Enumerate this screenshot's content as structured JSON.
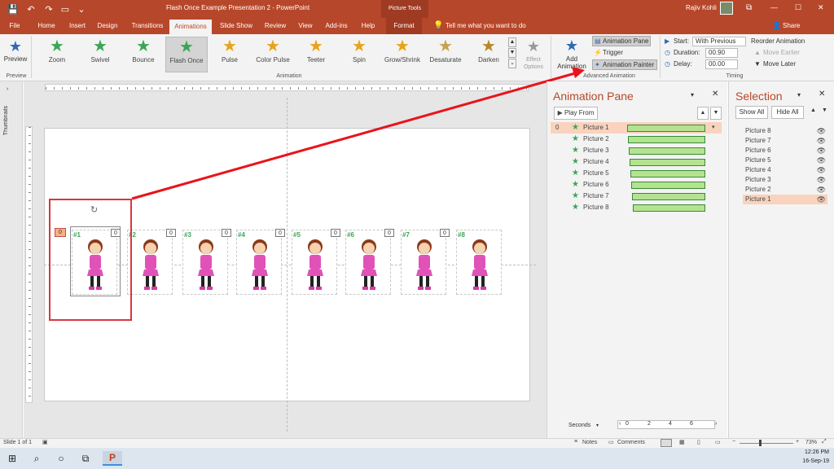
{
  "titlebar": {
    "title": "Flash Once Example Presentation 2  -  PowerPoint",
    "context_tab": "Picture Tools",
    "user": "Rajiv Kohli",
    "restore": "⧉",
    "close": "✕",
    "minimize": "—",
    "maximize": "☐"
  },
  "tabs": [
    "File",
    "Home",
    "Insert",
    "Design",
    "Transitions",
    "Animations",
    "Slide Show",
    "Review",
    "View",
    "Add-ins",
    "Help",
    "Format"
  ],
  "tellme": "Tell me what you want to do",
  "share": "Share",
  "ribbon": {
    "preview_label": "Preview",
    "preview_group": "Preview",
    "animations": [
      {
        "label": "Zoom",
        "color": "#3aa655"
      },
      {
        "label": "Swivel",
        "color": "#3aa655"
      },
      {
        "label": "Bounce",
        "color": "#3aa655"
      },
      {
        "label": "Flash Once",
        "color": "#3aa655"
      },
      {
        "label": "Pulse",
        "color": "#e8a317"
      },
      {
        "label": "Color Pulse",
        "color": "#e8a317"
      },
      {
        "label": "Teeter",
        "color": "#e8a317"
      },
      {
        "label": "Spin",
        "color": "#e8a317"
      },
      {
        "label": "Grow/Shrink",
        "color": "#e8a317"
      },
      {
        "label": "Desaturate",
        "color": "#c8a24a"
      },
      {
        "label": "Darken",
        "color": "#b8862a"
      }
    ],
    "animation_group": "Animation",
    "effect_options": "Effect Options",
    "add_animation": "Add Animation",
    "animation_pane": "Animation Pane",
    "trigger": "Trigger",
    "animation_painter": "Animation Painter",
    "advanced_group": "Advanced Animation",
    "start_label": "Start:",
    "start_value": "With Previous",
    "duration_label": "Duration:",
    "duration_value": "00.90",
    "delay_label": "Delay:",
    "delay_value": "00.00",
    "timing_group": "Timing",
    "reorder": "Reorder Animation",
    "move_earlier": "Move Earlier",
    "move_later": "Move Later"
  },
  "thumbnails_label": "Thumbnails",
  "slide": {
    "numbers": [
      "#1",
      "#2",
      "#3",
      "#4",
      "#5",
      "#6",
      "#7",
      "#8"
    ],
    "tags": [
      "0",
      "0",
      "0",
      "0",
      "0",
      "0",
      "0"
    ],
    "first_tag": "0"
  },
  "anim_pane": {
    "title": "Animation Pane",
    "play_from": "Play From",
    "row_index": "0",
    "items": [
      "Picture 1",
      "Picture 2",
      "Picture 3",
      "Picture 4",
      "Picture 5",
      "Picture 6",
      "Picture 7",
      "Picture 8"
    ],
    "seconds": "Seconds",
    "ticks": [
      "0",
      "2",
      "4",
      "6"
    ]
  },
  "sel_pane": {
    "title": "Selection",
    "show_all": "Show All",
    "hide_all": "Hide All",
    "items": [
      "Picture 8",
      "Picture 7",
      "Picture 6",
      "Picture 5",
      "Picture 4",
      "Picture 3",
      "Picture 2",
      "Picture 1"
    ]
  },
  "status": {
    "slide": "Slide 1 of 1",
    "notes": "Notes",
    "comments": "Comments",
    "zoom": "73%"
  },
  "taskbar": {
    "time": "12:26 PM",
    "date": "16-Sep-19"
  },
  "colors": {
    "accent": "#b7472a",
    "green": "#3aa655",
    "arrow": "#e8141c"
  }
}
